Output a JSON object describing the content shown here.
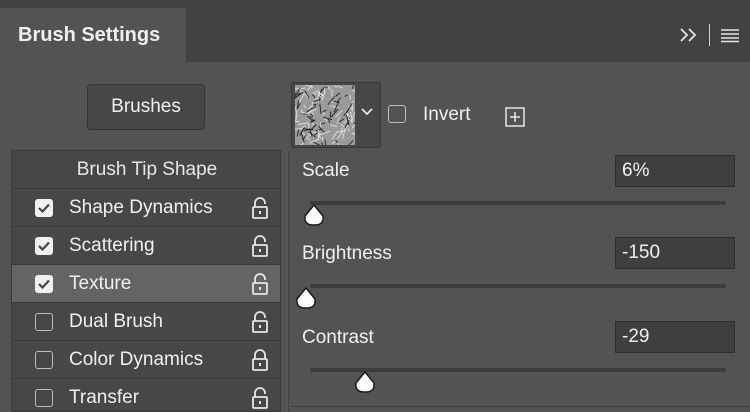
{
  "panel": {
    "title": "Brush Settings"
  },
  "header_icons": {
    "expand": "double-chevron-right-icon",
    "menu": "hamburger-menu-icon"
  },
  "brushes_button": {
    "label": "Brushes"
  },
  "options": {
    "header": "Brush Tip Shape",
    "items": [
      {
        "label": "Shape Dynamics",
        "checked": true,
        "lock": "unlocked"
      },
      {
        "label": "Scattering",
        "checked": true,
        "lock": "unlocked"
      },
      {
        "label": "Texture",
        "checked": true,
        "lock": "unlocked",
        "selected": true
      },
      {
        "label": "Dual Brush",
        "checked": false,
        "lock": "unlocked"
      },
      {
        "label": "Color Dynamics",
        "checked": false,
        "lock": "locked"
      },
      {
        "label": "Transfer",
        "checked": false,
        "lock": "unlocked"
      }
    ]
  },
  "texture": {
    "invert_label": "Invert",
    "invert_checked": false,
    "new_preset_icon": "plus-square-icon"
  },
  "sliders": [
    {
      "label": "Scale",
      "value": "6%",
      "fraction": 0.02
    },
    {
      "label": "Brightness",
      "value": "-150",
      "fraction": 0.0
    },
    {
      "label": "Contrast",
      "value": "-29",
      "fraction": 0.14
    }
  ],
  "colors": {
    "panel_bg": "#535353",
    "tab_bar_bg": "#424242",
    "selected_row": "#646464"
  }
}
